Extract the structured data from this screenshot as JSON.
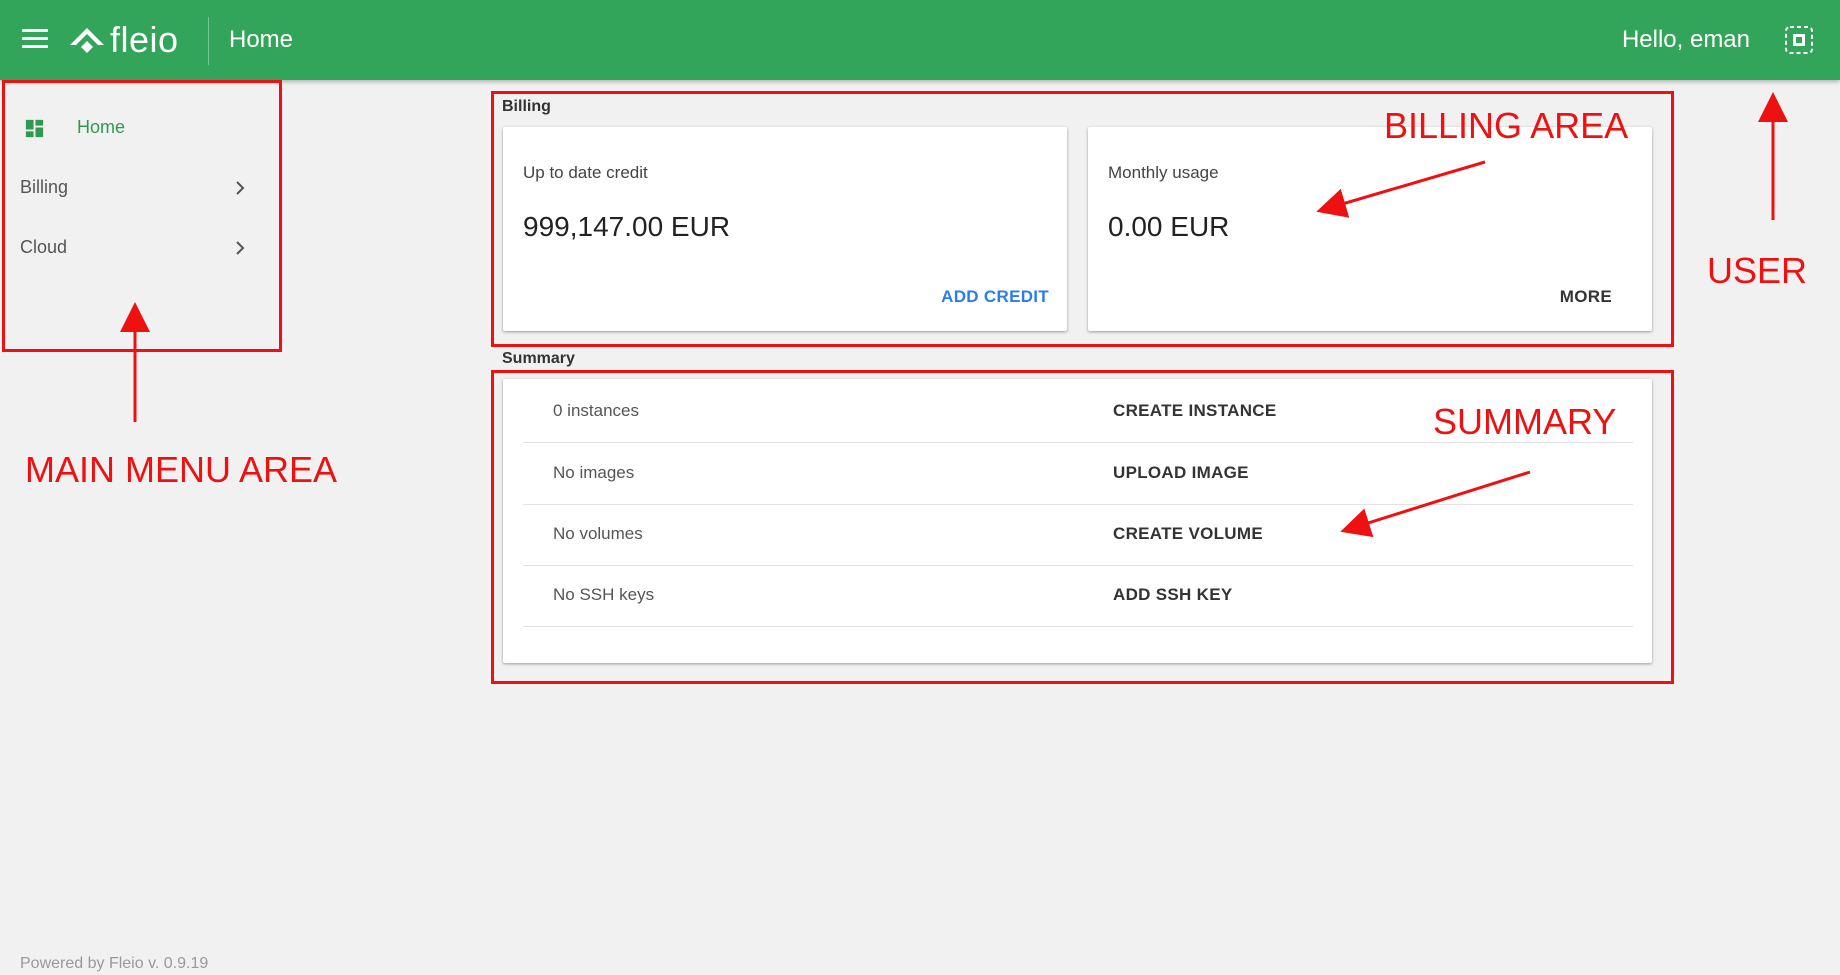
{
  "header": {
    "logo_text": "fleio",
    "page_title": "Home",
    "greeting": "Hello, eman"
  },
  "sidebar": {
    "items": [
      {
        "label": "Home",
        "icon": "dashboard-icon",
        "active": true
      },
      {
        "label": "Billing",
        "icon": "chevron-right-icon"
      },
      {
        "label": "Cloud",
        "icon": "chevron-right-icon"
      }
    ]
  },
  "billing": {
    "section_label": "Billing",
    "credit_card": {
      "title": "Up to date credit",
      "value": "999,147.00 EUR",
      "action": "ADD CREDIT"
    },
    "usage_card": {
      "title": "Monthly usage",
      "value": "0.00 EUR",
      "action": "MORE"
    }
  },
  "summary": {
    "section_label": "Summary",
    "rows": [
      {
        "label": "0 instances",
        "action": "CREATE INSTANCE"
      },
      {
        "label": "No images",
        "action": "UPLOAD IMAGE"
      },
      {
        "label": "No volumes",
        "action": "CREATE VOLUME"
      },
      {
        "label": "No SSH keys",
        "action": "ADD SSH KEY"
      }
    ]
  },
  "annotations": {
    "main_menu": "MAIN MENU AREA",
    "billing": "BILLING AREA",
    "summary": "SUMMARY",
    "user": "USER"
  },
  "footer": {
    "text": "Powered by Fleio v. 0.9.19"
  },
  "colors": {
    "primary_green": "#33a55a",
    "active_green": "#2f9a4f",
    "link_blue": "#2b7de9",
    "annotation_red": "#ee1111",
    "background": "#f1f1f1"
  }
}
